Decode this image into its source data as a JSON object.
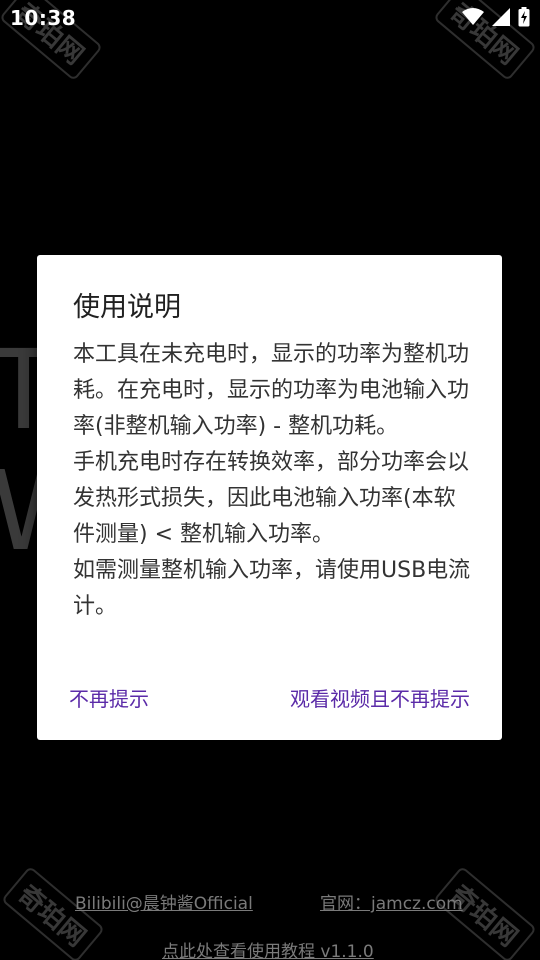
{
  "status_bar": {
    "time": "10:38",
    "icons": [
      "wifi-icon",
      "cellular-signal-icon",
      "battery-charging-icon"
    ]
  },
  "background": {
    "ghost_text": "T\nW",
    "watermark_text": "奇珀网"
  },
  "dialog": {
    "title": "使用说明",
    "paragraphs": [
      "本工具在未充电时，显示的功率为整机功耗。在充电时，显示的功率为电池输入功率(非整机输入功率) - 整机功耗。",
      "手机充电时存在转换效率，部分功率会以发热形式损失，因此电池输入功率(本软件测量) < 整机输入功率。",
      "如需测量整机输入功率，请使用USB电流计。"
    ],
    "actions": {
      "dismiss_label": "不再提示",
      "watch_video_label": "观看视频且不再提示"
    }
  },
  "footer": {
    "bilibili_label": "Bilibili@晨钟酱Official",
    "site_label": "官网：jamcz.com",
    "tutorial_label": "点此处查看使用教程 v1.1.0"
  },
  "colors": {
    "background": "#000000",
    "dialog_background": "#ffffff",
    "accent": "#5b2ba8",
    "footer_link": "#7a7a7a"
  }
}
